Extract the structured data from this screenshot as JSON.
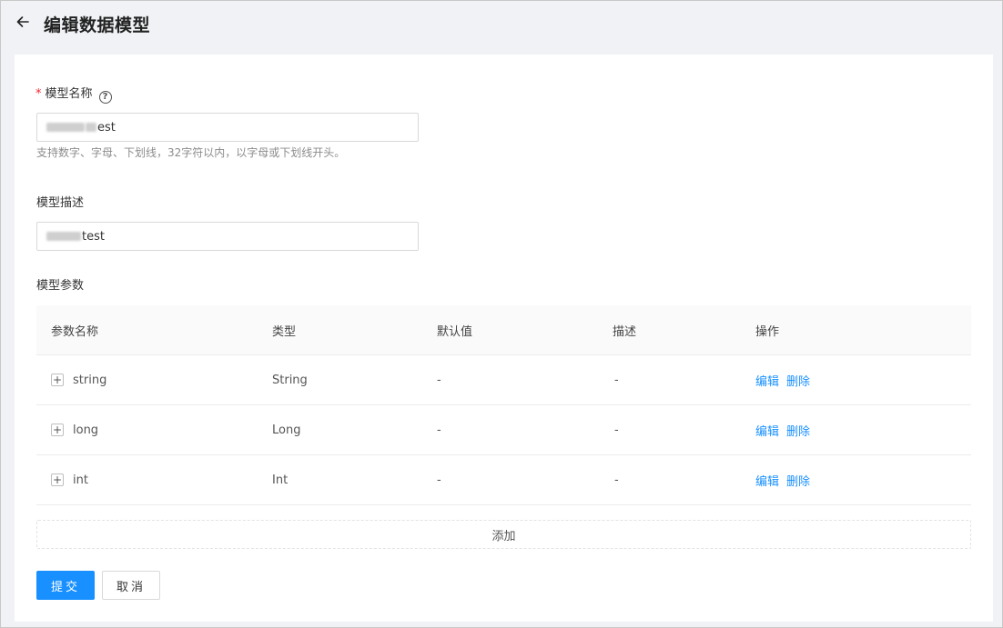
{
  "header": {
    "title": "编辑数据模型"
  },
  "form": {
    "name_label": "模型名称",
    "name_required_mark": "*",
    "name_value_suffix": "est",
    "name_hint": "支持数字、字母、下划线，32字符以内，以字母或下划线开头。",
    "desc_label": "模型描述",
    "desc_value_suffix": "test",
    "params_label": "模型参数"
  },
  "table": {
    "columns": [
      "参数名称",
      "类型",
      "默认值",
      "描述",
      "操作"
    ],
    "rows": [
      {
        "name": "string",
        "type": "String",
        "default": "-",
        "desc": "-"
      },
      {
        "name": "long",
        "type": "Long",
        "default": "-",
        "desc": "-"
      },
      {
        "name": "int",
        "type": "Int",
        "default": "-",
        "desc": "-"
      }
    ],
    "edit_label": "编辑",
    "delete_label": "删除",
    "expand_symbol": "+",
    "add_label": "添加"
  },
  "actions": {
    "submit_label": "提交",
    "cancel_label": "取消"
  },
  "colors": {
    "primary": "#1890ff",
    "required": "#f5222d"
  }
}
